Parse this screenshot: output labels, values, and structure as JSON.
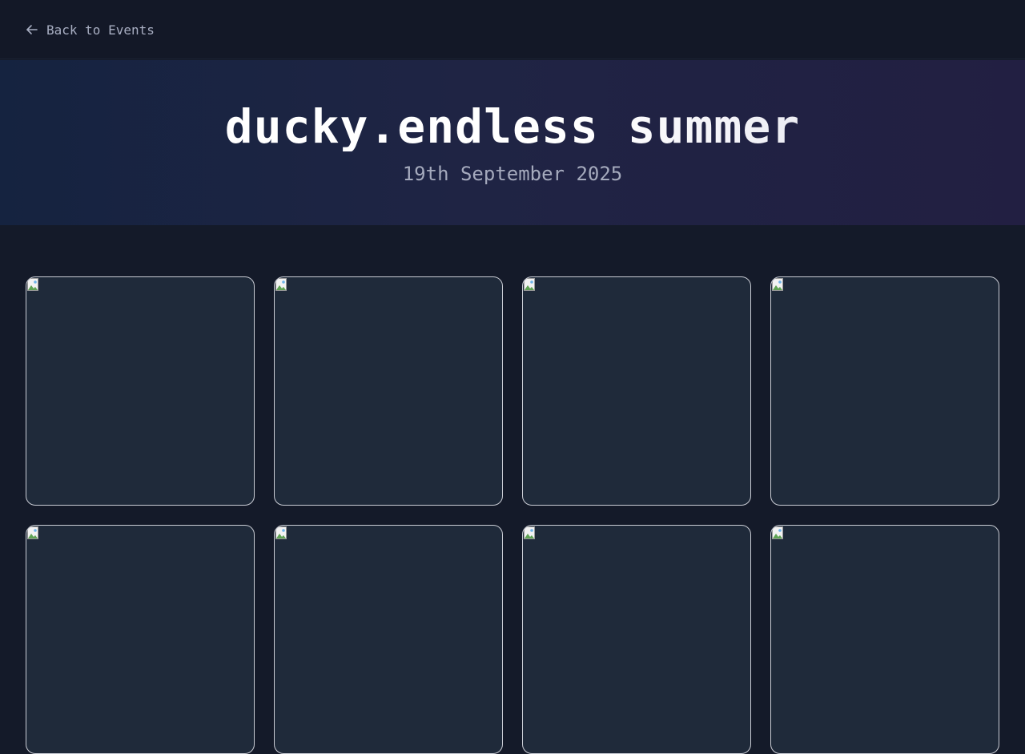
{
  "nav": {
    "back_label": "Back to Events"
  },
  "hero": {
    "title": "ducky.endless summer",
    "date": "19th September 2025"
  },
  "gallery": {
    "photos": [
      {
        "icon": "broken-image-icon"
      },
      {
        "icon": "broken-image-icon"
      },
      {
        "icon": "broken-image-icon"
      },
      {
        "icon": "broken-image-icon"
      },
      {
        "icon": "broken-image-icon"
      },
      {
        "icon": "broken-image-icon"
      },
      {
        "icon": "broken-image-icon"
      },
      {
        "icon": "broken-image-icon"
      }
    ]
  },
  "colors": {
    "background": "#141a29",
    "topbar": "#131827",
    "hero_gradient_start": "#152340",
    "hero_gradient_end": "#221f42",
    "photo_placeholder": "#1f2a3a",
    "muted_text": "#a8aec2"
  }
}
